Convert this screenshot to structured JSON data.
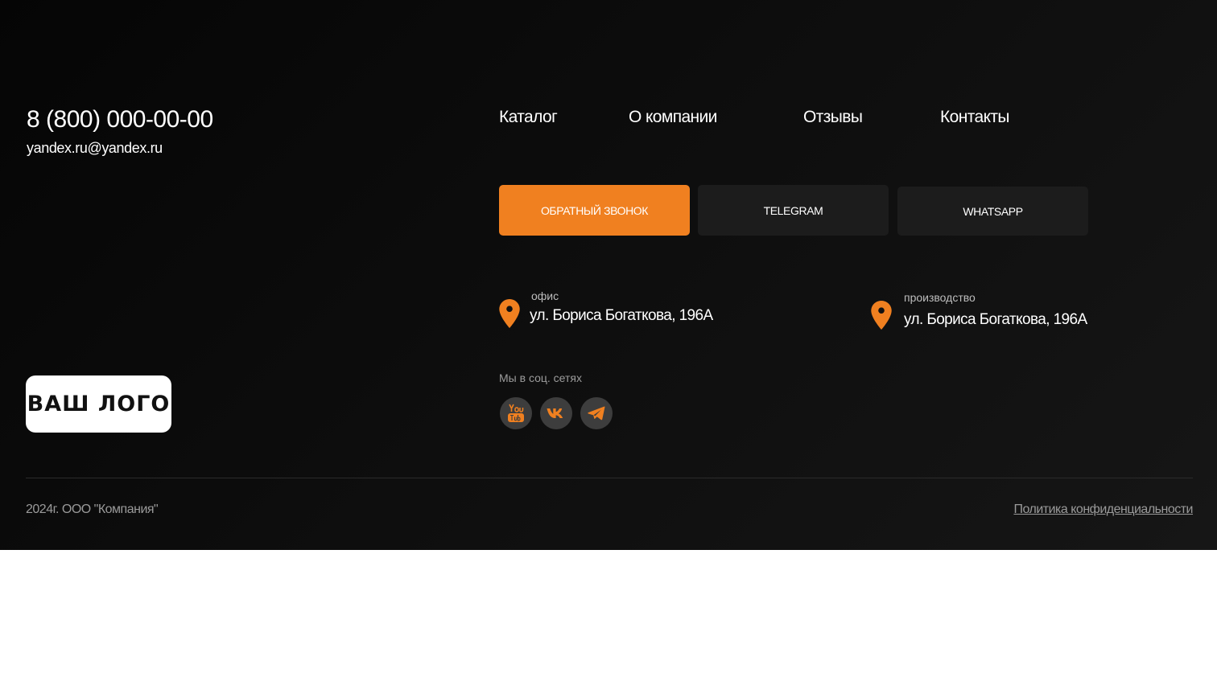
{
  "contacts": {
    "phone": "8 (800) 000-00-00",
    "email": "yandex.ru@yandex.ru"
  },
  "nav": {
    "items": [
      {
        "label": "Каталог"
      },
      {
        "label": "О компании"
      },
      {
        "label": "Отзывы"
      },
      {
        "label": "Контакты"
      }
    ]
  },
  "buttons": {
    "callback": "ОБРАТНЫЙ ЗВОНОК",
    "telegram": "TELEGRAM",
    "whatsapp": "WHATSAPP"
  },
  "addresses": [
    {
      "label": "офис",
      "value": "ул. Бориса Богаткова, 196А"
    },
    {
      "label": "производство",
      "value": "ул. Бориса Богаткова, 196А"
    }
  ],
  "social": {
    "label": "Мы в соц. сетях",
    "icons": [
      "youtube-icon",
      "vk-icon",
      "telegram-icon"
    ]
  },
  "logo": {
    "text": "ВАШ ЛОГО"
  },
  "bottom": {
    "copyright": "2024г. ООО \"Компания\"",
    "policy": "Политика конфиденциальности"
  },
  "colors": {
    "accent": "#f08020",
    "background": "#0d0d0d",
    "button_dark": "#1c1c1c",
    "social_bg": "#3d3d3d"
  }
}
